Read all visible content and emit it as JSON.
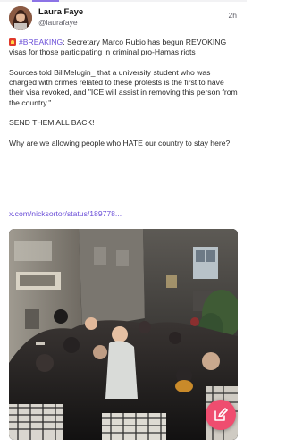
{
  "post": {
    "author_name": "Laura Faye",
    "author_handle": "@laurafaye",
    "timestamp": "2h",
    "hashtag": "#BREAKING",
    "paragraph_1_rest": ": Secretary Marco Rubio has begun REVOKING visas for those participating in criminal pro-Hamas riots",
    "paragraph_2": "Sources told BillMelugin_ that a university student who was charged with crimes related to these protests is the first to have their visa revoked, and \"ICE will assist in removing this person from the country.\"",
    "paragraph_3": "SEND THEM ALL BACK!",
    "paragraph_4": "Why are we allowing people who HATE our country to stay here?!",
    "link_text": "x.com/nicksortor/status/189778..."
  },
  "icons": {
    "alert": "siren-icon",
    "compose": "compose-icon"
  },
  "colors": {
    "accent": "#6b4fd8",
    "fab": "#ef4d6f",
    "alert": "#e0392b"
  }
}
